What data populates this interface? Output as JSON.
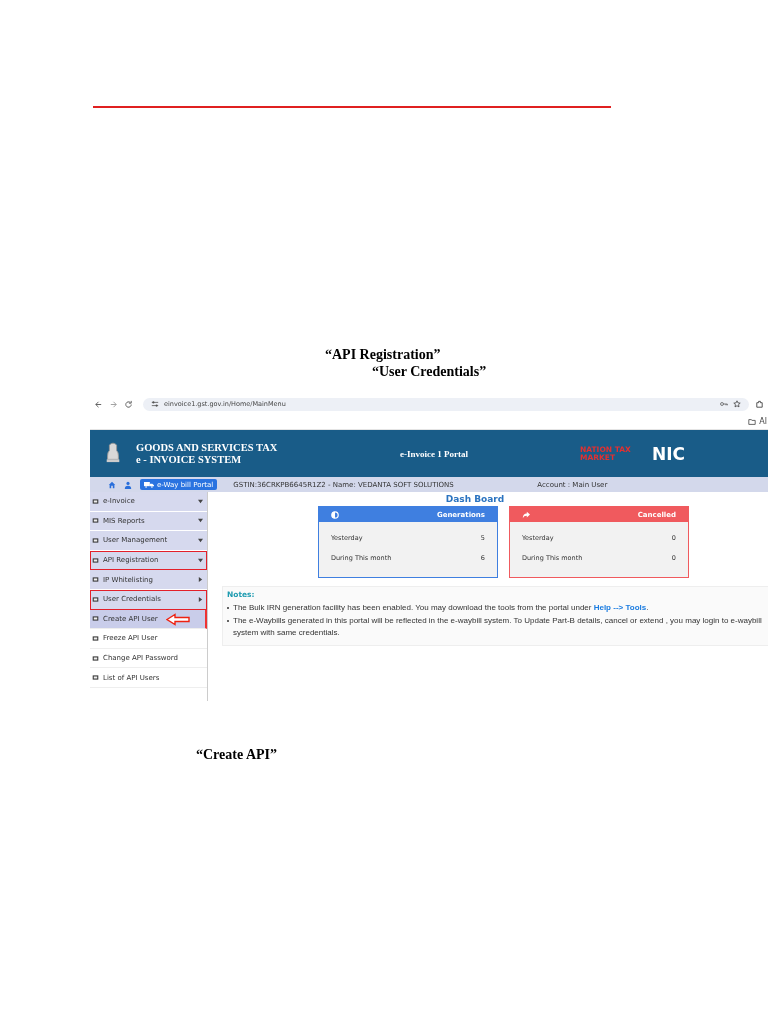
{
  "captions": [
    {
      "text": "“API Registration”",
      "kind": "upper"
    },
    {
      "text": "“User Credentials”",
      "kind": "lower"
    }
  ],
  "screenshot": {
    "browser": {
      "url": "einvoice1.gst.gov.in/Home/MainMenu",
      "bookmark": "Al"
    },
    "header": {
      "title_line1": "GOODS AND SERVICES TAX",
      "title_line2": "e - INVOICE SYSTEM",
      "portal": "e-Invoice 1 Portal",
      "logo_text": "NATION TAX MARKET",
      "nic": "NIC"
    },
    "subbar": {
      "eway_button": "e-Way bill Portal",
      "gstin": "GSTIN:36CRKPB6645R1Z2 - Name: VEDANTA SOFT SOLUTIONS",
      "account": "Account : Main User"
    },
    "sidebar": [
      {
        "label": "e-Invoice",
        "kind": "menu",
        "expanded": true,
        "highlighted": false,
        "selected": false,
        "pointer": false
      },
      {
        "label": "MIS Reports",
        "kind": "menu",
        "expanded": true,
        "highlighted": false,
        "selected": false,
        "pointer": false
      },
      {
        "label": "User Management",
        "kind": "menu",
        "expanded": true,
        "highlighted": false,
        "selected": false,
        "pointer": false
      },
      {
        "label": "API Registration",
        "kind": "menu",
        "expanded": true,
        "highlighted": true,
        "selected": false,
        "pointer": false
      },
      {
        "label": "IP Whitelisting",
        "kind": "menu",
        "expanded": false,
        "highlighted": false,
        "selected": false,
        "pointer": false
      },
      {
        "label": "User Credentials",
        "kind": "menu",
        "expanded": false,
        "highlighted": true,
        "selected": false,
        "pointer": false
      },
      {
        "label": "Create API User",
        "kind": "submenu",
        "highlighted": false,
        "selected": true,
        "pointer": true
      },
      {
        "label": "Freeze API User",
        "kind": "submenu",
        "highlighted": false,
        "selected": false,
        "pointer": false
      },
      {
        "label": "Change API Password",
        "kind": "submenu",
        "highlighted": false,
        "selected": false,
        "pointer": false
      },
      {
        "label": "List of API Users",
        "kind": "submenu",
        "highlighted": false,
        "selected": false,
        "pointer": false
      }
    ],
    "dashboard": {
      "title": "Dash Board",
      "cards": [
        {
          "title": "Generations",
          "kind": "generations",
          "color": "#3f7fe0",
          "rows": [
            {
              "label": "Yesterday",
              "value": "5"
            },
            {
              "label": "During This month",
              "value": "6"
            }
          ]
        },
        {
          "title": "Cancelled",
          "kind": "cancelled",
          "color": "#f05a5e",
          "rows": [
            {
              "label": "Yesterday",
              "value": "0"
            },
            {
              "label": "During This month",
              "value": "0"
            }
          ]
        }
      ]
    },
    "notes": {
      "title": "Notes:",
      "items": [
        {
          "text": "The Bulk IRN generation facility has been enabled. You may download the tools from the portal under",
          "link": "Help --> Tools",
          "after": "."
        },
        {
          "text": "The e-Waybills generated in this portal will be reflected in the e-waybill system. To Update Part-B details, cancel or extend , you may login to e-waybill system with same credentials."
        }
      ]
    }
  },
  "bottom_caption": "“Create API”"
}
